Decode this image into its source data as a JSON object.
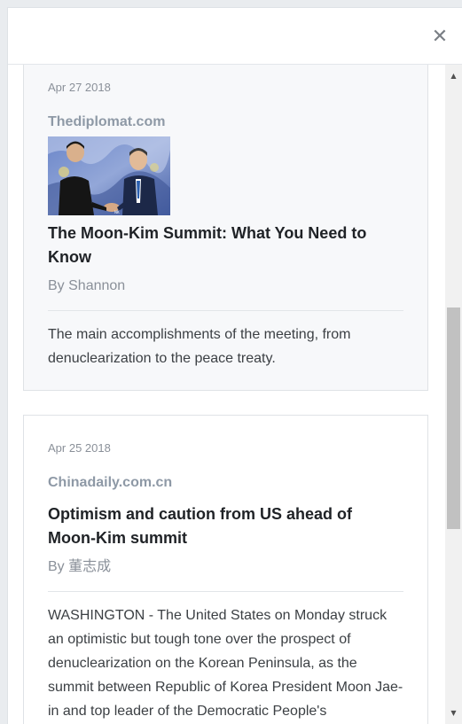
{
  "header": {
    "close_icon": "close-icon",
    "close_glyph": "✕"
  },
  "articles": [
    {
      "date": "Apr 27 2018",
      "source": "Thediplomat.com",
      "has_image": true,
      "title": "The Moon-Kim Summit: What You Need to Know",
      "byline": "By Shannon",
      "summary": "The main accomplishments of the meeting, from denuclearization to the peace treaty."
    },
    {
      "date": "Apr 25 2018",
      "source": "Chinadaily.com.cn",
      "has_image": false,
      "title": "Optimism and caution from US ahead of Moon-Kim summit",
      "byline": "By 董志成",
      "summary": "WASHINGTON - The United States on Monday struck an optimistic but tough tone over the prospect of denuclearization on the Korean Peninsula, as the summit between Republic of Korea President Moon Jae-in and top leader of the Democratic People's"
    }
  ],
  "scrollbar": {
    "up_glyph": "▲",
    "down_glyph": "▼"
  }
}
